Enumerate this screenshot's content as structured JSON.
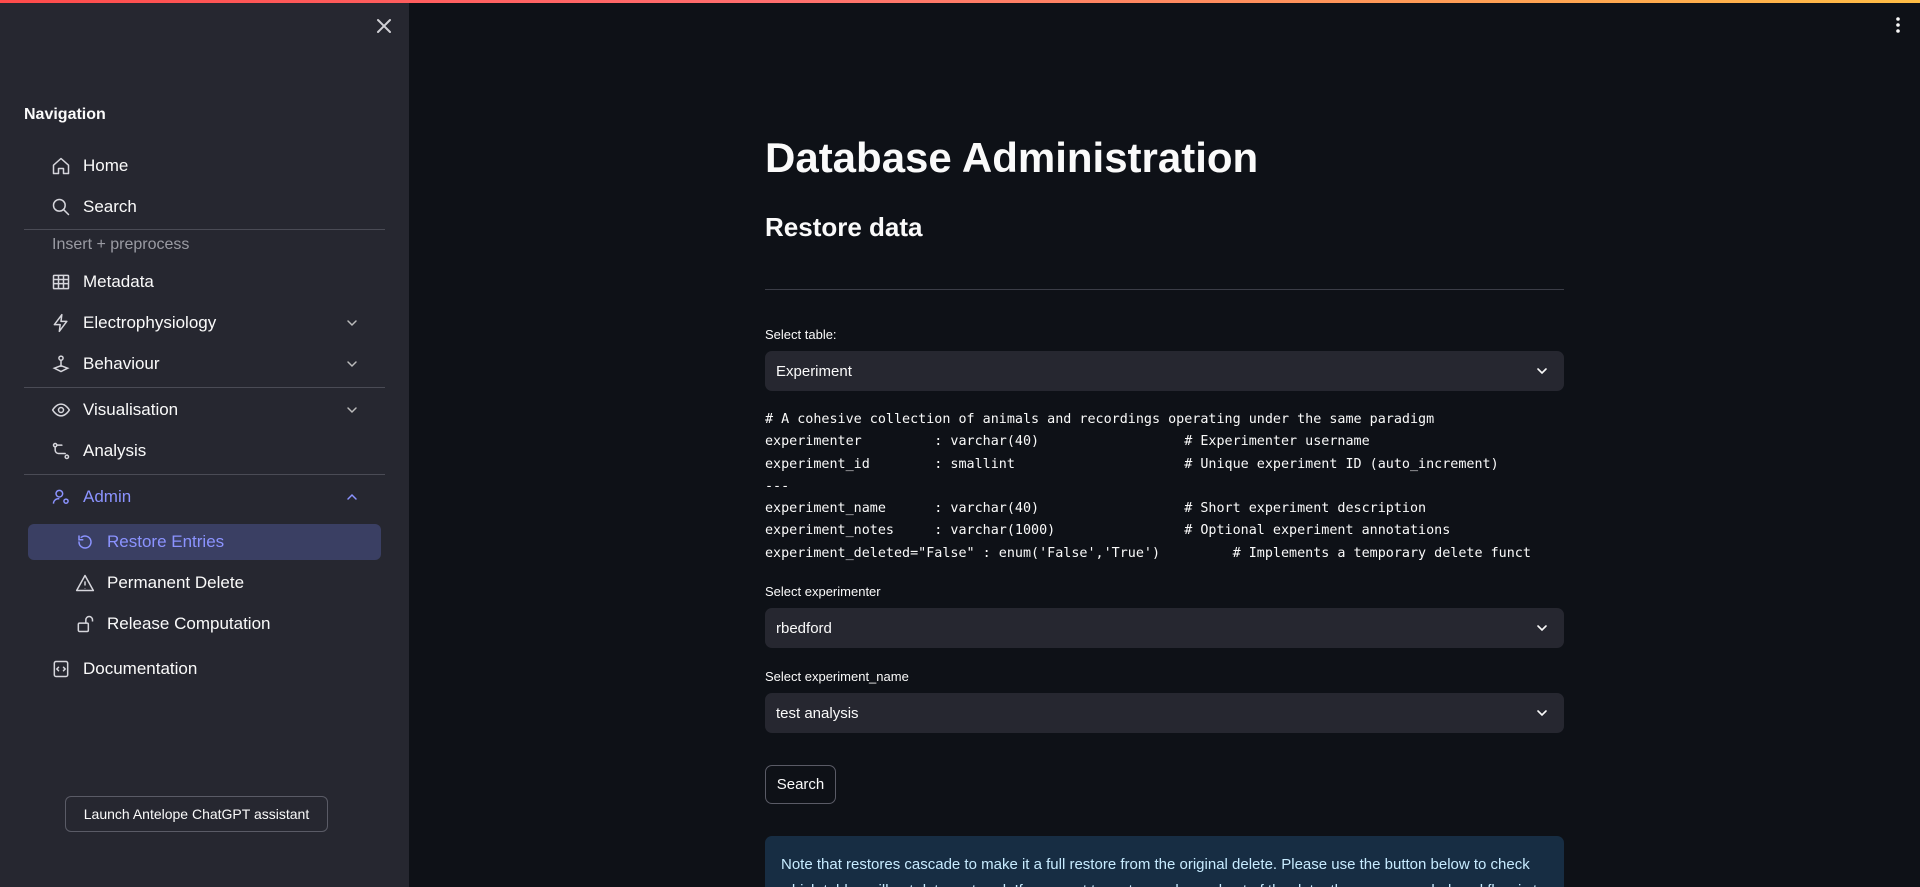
{
  "sidebar": {
    "heading": "Navigation",
    "items": [
      {
        "label": "Home",
        "icon": "home-icon"
      },
      {
        "label": "Search",
        "icon": "search-icon"
      }
    ],
    "section_label": "Insert + preprocess",
    "preprocess_items": [
      {
        "label": "Metadata",
        "icon": "table-icon"
      },
      {
        "label": "Electrophysiology",
        "icon": "bolt-icon"
      },
      {
        "label": "Behaviour",
        "icon": "joystick-icon"
      }
    ],
    "analysis_items": [
      {
        "label": "Visualisation",
        "icon": "eye-icon"
      },
      {
        "label": "Analysis",
        "icon": "workflow-icon"
      }
    ],
    "admin": {
      "label": "Admin",
      "icon": "user-admin-icon",
      "children": [
        {
          "label": "Restore Entries",
          "icon": "restore-icon",
          "active": true
        },
        {
          "label": "Permanent Delete",
          "icon": "warning-icon"
        },
        {
          "label": "Release Computation",
          "icon": "unlock-icon"
        }
      ]
    },
    "documentation": {
      "label": "Documentation",
      "icon": "doc-icon"
    },
    "assistant_button": "Launch Antelope ChatGPT assistant"
  },
  "main": {
    "title": "Database Administration",
    "subtitle": "Restore data",
    "select_table": {
      "label": "Select table:",
      "value": "Experiment"
    },
    "table_definition": [
      "# A cohesive collection of animals and recordings operating under the same paradigm",
      "experimenter         : varchar(40)                  # Experimenter username",
      "experiment_id        : smallint                     # Unique experiment ID (auto_increment)",
      "---",
      "experiment_name      : varchar(40)                  # Short experiment description",
      "experiment_notes     : varchar(1000)                # Optional experiment annotations",
      "experiment_deleted=\"False\" : enum('False','True')         # Implements a temporary delete funct"
    ],
    "select_experimenter": {
      "label": "Select experimenter",
      "value": "rbedford"
    },
    "select_experiment_name": {
      "label": "Select experiment_name",
      "value": "test analysis"
    },
    "search_button": "Search",
    "info_text": "Note that restores cascade to make it a full restore from the original delete. Please use the button below to check which tables will get data restored. If you want to restore only a subset of the data, the recommended workflow is to"
  },
  "colors": {
    "accent": "#8b93ff",
    "sidebar_bg": "#262730",
    "main_bg": "#0e1117",
    "info_bg": "#172d43"
  }
}
